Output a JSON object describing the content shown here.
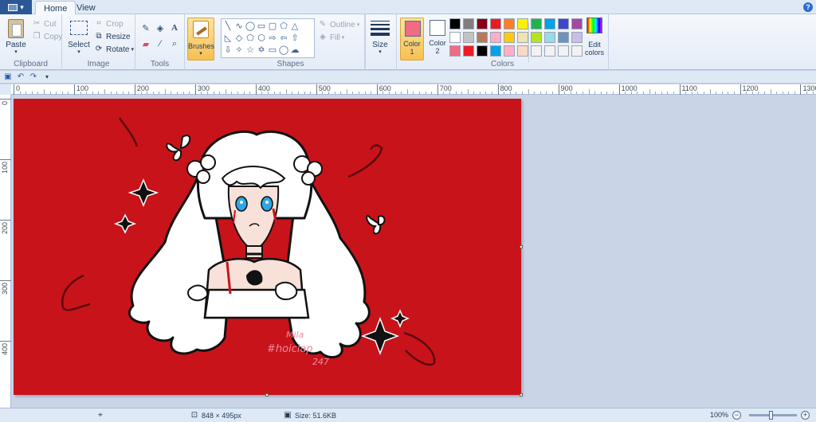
{
  "tabs": [
    {
      "label": "Home"
    },
    {
      "label": "View"
    }
  ],
  "clipboard": {
    "paste": "Paste",
    "cut": "Cut",
    "copy": "Copy",
    "label": "Clipboard"
  },
  "image": {
    "select": "Select",
    "crop": "Crop",
    "resize": "Resize",
    "rotate": "Rotate",
    "label": "Image"
  },
  "tools": {
    "label": "Tools",
    "text_glyph": "A"
  },
  "brushes": {
    "label": "Brushes"
  },
  "shapes": {
    "outline": "Outline",
    "fill": "Fill",
    "label": "Shapes"
  },
  "size": {
    "label": "Size"
  },
  "colors": {
    "color1": "Color\n1",
    "color1_line1": "Color",
    "color1_line2": "1",
    "color2_line1": "Color",
    "color2_line2": "2",
    "edit_line1": "Edit",
    "edit_line2": "colors",
    "label": "Colors",
    "color1_value": "#f06b84",
    "color2_value": "#ffffff",
    "palette": [
      "#000000",
      "#7f7f7f",
      "#880015",
      "#ed1c24",
      "#ff7f27",
      "#fff200",
      "#22b14c",
      "#00a2e8",
      "#3f48cc",
      "#a349a4",
      "#ffffff",
      "#c3c3c3",
      "#b97a57",
      "#ffaec9",
      "#ffc90e",
      "#efe4b0",
      "#b5e61d",
      "#99d9ea",
      "#7092be",
      "#c8bfe7",
      "#f06b84",
      "#ed1c24",
      "#000000",
      "#00a2e8",
      "#ffaec9",
      "#ffd8c8",
      "#f2f2f2",
      "#f2f2f2",
      "#f2f2f2",
      "#f2f2f2"
    ]
  },
  "ruler": {
    "h_ticks": [
      "0",
      "100",
      "200",
      "300",
      "400",
      "500",
      "600",
      "700",
      "800",
      "900",
      "1000",
      "1100",
      "1200",
      "1300"
    ],
    "v_ticks": [
      "0",
      "100",
      "200",
      "300",
      "400"
    ]
  },
  "canvas": {
    "background": "#c8131a",
    "signature": "Mila\n#hoiclap\n247"
  },
  "status": {
    "dimensions": "848 × 495px",
    "size": "Size: 51.6KB",
    "zoom": "100%"
  }
}
